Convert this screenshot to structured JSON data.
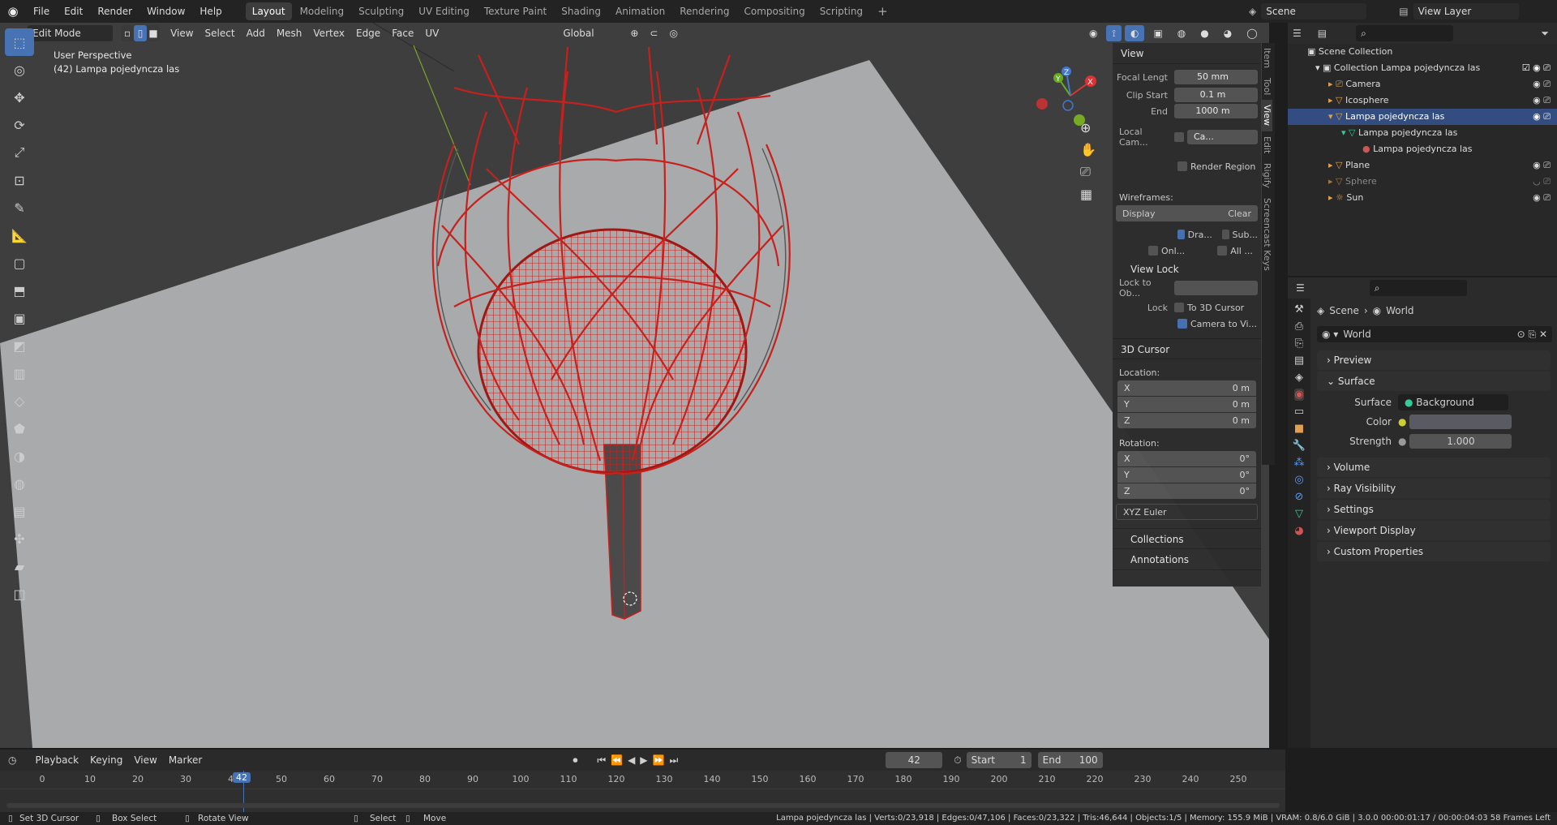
{
  "topbar": {
    "menus": [
      "File",
      "Edit",
      "Render",
      "Window",
      "Help"
    ],
    "workspaces": [
      "Layout",
      "Modeling",
      "Sculpting",
      "UV Editing",
      "Texture Paint",
      "Shading",
      "Animation",
      "Rendering",
      "Compositing",
      "Scripting"
    ],
    "active_workspace": "Layout",
    "add_workspace": "+",
    "scene_name": "Scene",
    "view_layer": "View Layer"
  },
  "viewport_header": {
    "mode": "Edit Mode",
    "menus": [
      "View",
      "Select",
      "Add",
      "Mesh",
      "Vertex",
      "Edge",
      "Face",
      "UV"
    ],
    "orientation": "Global"
  },
  "viewport": {
    "perspective_label": "User Perspective",
    "object_label": "(42) Lampa pojedyncza las"
  },
  "npanel": {
    "view_header": "View",
    "focal_length_label": "Focal Lengt",
    "focal_length": "50 mm",
    "clip_start_label": "Clip Start",
    "clip_start": "0.1 m",
    "clip_end_label": "End",
    "clip_end": "1000 m",
    "local_camera_label": "Local Cam...",
    "local_camera_value": "Ca...",
    "render_region": "Render Region",
    "wireframes_label": "Wireframes:",
    "display_btn": "Display",
    "clear_btn": "Clear",
    "draw_chk": "Dra...",
    "sub_chk": "Sub...",
    "only_chk": "Onl...",
    "all_chk": "All ...",
    "view_lock_header": "View Lock",
    "lock_to_obj": "Lock to Ob...",
    "lock_label": "Lock",
    "to_3d_cursor": "To 3D Cursor",
    "camera_to_view": "Camera to Vi...",
    "cursor_header": "3D Cursor",
    "location_label": "Location:",
    "loc_x": "0 m",
    "loc_y": "0 m",
    "loc_z": "0 m",
    "rotation_label": "Rotation:",
    "rot_x": "0°",
    "rot_y": "0°",
    "rot_z": "0°",
    "rot_mode": "XYZ Euler",
    "collections_header": "Collections",
    "annotations_header": "Annotations",
    "tabs": [
      "Item",
      "Tool",
      "View",
      "Edit",
      "Rigify",
      "Screencast Keys"
    ],
    "axis_labels": {
      "x": "X",
      "y": "Y",
      "z": "Z"
    }
  },
  "outliner": {
    "rows": [
      {
        "label": "Scene Collection"
      },
      {
        "label": "Collection Lampa pojedyncza las"
      },
      {
        "label": "Camera"
      },
      {
        "label": "Icosphere"
      },
      {
        "label": "Lampa pojedyncza las"
      },
      {
        "label": "Lampa pojedyncza las"
      },
      {
        "label": "Lampa pojedyncza las"
      },
      {
        "label": "Plane"
      },
      {
        "label": "Sphere"
      },
      {
        "label": "Sun"
      }
    ]
  },
  "properties": {
    "breadcrumb_scene": "Scene",
    "breadcrumb_world": "World",
    "world_name": "World",
    "panels": [
      "Preview",
      "Surface",
      "Volume",
      "Ray Visibility",
      "Settings",
      "Viewport Display",
      "Custom Properties"
    ],
    "surface_label": "Surface",
    "surface_value": "Background",
    "color_label": "Color",
    "strength_label": "Strength",
    "strength_value": "1.000"
  },
  "timeline": {
    "menus": [
      "Playback",
      "Keying",
      "View",
      "Marker"
    ],
    "current_frame": "42",
    "start_label": "Start",
    "start_value": "1",
    "end_label": "End",
    "end_value": "100",
    "ruler": [
      "0",
      "10",
      "20",
      "30",
      "40",
      "50",
      "60",
      "70",
      "80",
      "90",
      "100",
      "110",
      "120",
      "130",
      "140",
      "150",
      "160",
      "170",
      "180",
      "190",
      "200",
      "210",
      "220",
      "230",
      "240",
      "250"
    ],
    "playhead": "42"
  },
  "statusbar": {
    "set_cursor": "Set 3D Cursor",
    "box_select": "Box Select",
    "rotate_view": "Rotate View",
    "select": "Select",
    "move": "Move",
    "stats": "Lampa pojedyncza las | Verts:0/23,918 | Edges:0/47,106 | Faces:0/23,322 | Tris:46,644 | Objects:1/5 | Memory: 155.9 MiB | VRAM: 0.8/6.0 GiB | 3.0.0 00:00:01:17 / 00:00:04:03 58 Frames Left"
  },
  "colors": {
    "accent": "#4772b3",
    "wire": "#c8201c",
    "timeline_head": "#4772b3"
  }
}
